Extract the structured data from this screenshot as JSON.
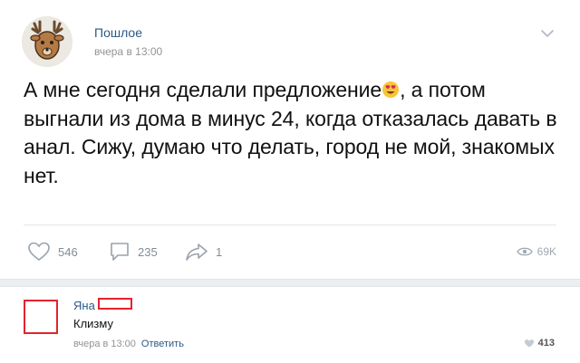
{
  "post": {
    "author": "Пошлое",
    "time": "вчера в 13:00",
    "text_part1": "А мне сегодня сделали предложение",
    "text_part2": ", а потом выгнали из дома в минус 24, когда отказалась давать в анал. Сижу, думаю что делать, город не мой, знакомых нет.",
    "likes": "546",
    "comments": "235",
    "shares": "1",
    "views": "69K"
  },
  "comment": {
    "author": "Яна",
    "text": "Клизму",
    "time": "вчера в 13:00",
    "reply_label": "Ответить",
    "likes": "413"
  },
  "colors": {
    "link": "#2a5885",
    "muted": "#818c99",
    "redaction": "#e3242b"
  },
  "icons": [
    "chevron-down-icon",
    "heart-icon",
    "comment-icon",
    "share-icon",
    "eye-icon",
    "heart-filled-icon",
    "heart-eyes-emoji"
  ]
}
